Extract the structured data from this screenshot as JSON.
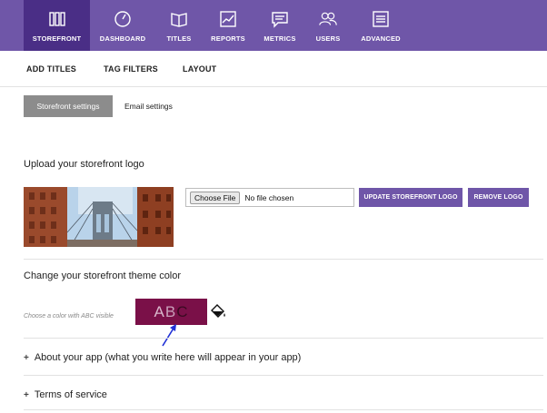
{
  "nav": {
    "items": [
      {
        "label": "STOREFRONT",
        "icon": "storefront-books-icon",
        "active": true
      },
      {
        "label": "DASHBOARD",
        "icon": "speedometer-icon"
      },
      {
        "label": "TITLES",
        "icon": "open-book-icon"
      },
      {
        "label": "REPORTS",
        "icon": "line-chart-icon"
      },
      {
        "label": "METRICS",
        "icon": "chat-bubble-icon"
      },
      {
        "label": "USERS",
        "icon": "users-icon"
      },
      {
        "label": "ADVANCED",
        "icon": "list-icon"
      }
    ]
  },
  "subnav": {
    "items": [
      "ADD TITLES",
      "TAG FILTERS",
      "LAYOUT"
    ]
  },
  "settings_tabs": {
    "active": "Storefront settings",
    "other": "Email settings"
  },
  "logo_section": {
    "title": "Upload your storefront logo",
    "choose_file_label": "Choose File",
    "no_file_text": "No file chosen",
    "update_button": "UPDATE STOREFRONT LOGO",
    "remove_button": "REMOVE LOGO"
  },
  "theme_section": {
    "title": "Change your storefront theme color",
    "hint": "Choose a color with ABC visible",
    "swatch_letters": [
      "A",
      "B",
      "C"
    ],
    "swatch_color": "#7a1048"
  },
  "collapsibles": [
    {
      "symbol": "+",
      "label": "About your app (what you write here will appear in your app)"
    },
    {
      "symbol": "+",
      "label": "Terms of service"
    }
  ],
  "colors": {
    "brand_purple": "#6f56a8",
    "active_nav": "#4a2e86",
    "annotation_arrow": "#1f2fd6"
  }
}
